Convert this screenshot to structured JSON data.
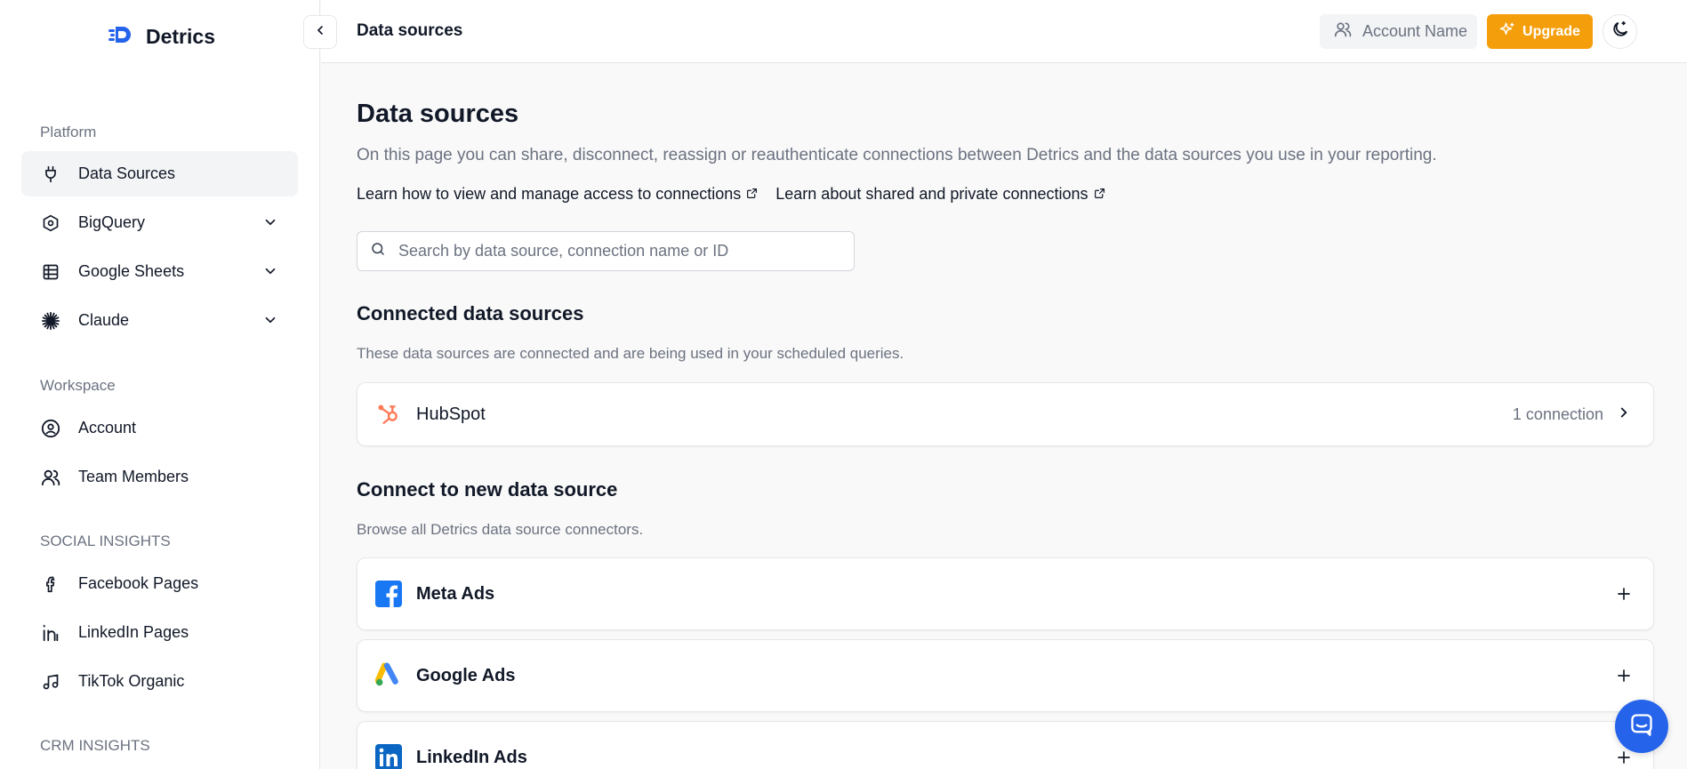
{
  "app": {
    "name": "Detrics"
  },
  "sidebar": {
    "sections": [
      {
        "title": "Platform"
      },
      {
        "title": "Workspace"
      },
      {
        "title": "SOCIAL INSIGHTS"
      },
      {
        "title": "CRM INSIGHTS"
      }
    ],
    "items": [
      {
        "label": "Data Sources",
        "icon": "plug-icon",
        "active": true
      },
      {
        "label": "BigQuery",
        "icon": "bigquery-icon",
        "expandable": true
      },
      {
        "label": "Google Sheets",
        "icon": "table-icon",
        "expandable": true
      },
      {
        "label": "Claude",
        "icon": "claude-icon",
        "expandable": true
      },
      {
        "label": "Account",
        "icon": "user-circle-icon"
      },
      {
        "label": "Team Members",
        "icon": "users-icon"
      },
      {
        "label": "Facebook Pages",
        "icon": "facebook-icon"
      },
      {
        "label": "LinkedIn Pages",
        "icon": "linkedin-icon"
      },
      {
        "label": "TikTok Organic",
        "icon": "music-note-icon"
      }
    ]
  },
  "header": {
    "title": "Data sources",
    "account_label": "Account Name",
    "upgrade_label": "Upgrade"
  },
  "main": {
    "title": "Data sources",
    "description": "On this page you can share, disconnect, reassign or reauthenticate connections between Detrics and the data sources you use in your reporting.",
    "links": [
      "Learn how to view and manage access to connections",
      "Learn about shared and private connections"
    ],
    "search_placeholder": "Search by data source, connection name or ID",
    "connected": {
      "title": "Connected data sources",
      "subtitle": "These data sources are connected and are being used in your scheduled queries.",
      "items": [
        {
          "name": "HubSpot",
          "meta": "1 connection",
          "icon": "hubspot-icon"
        }
      ]
    },
    "new_source": {
      "title": "Connect to new data source",
      "subtitle": "Browse all Detrics data source connectors.",
      "items": [
        {
          "name": "Meta Ads",
          "icon": "meta-icon"
        },
        {
          "name": "Google Ads",
          "icon": "google-ads-icon"
        },
        {
          "name": "LinkedIn Ads",
          "icon": "linkedin-ads-icon"
        }
      ]
    }
  },
  "colors": {
    "accent": "#f59e0b",
    "hubspot": "#ff7a59",
    "facebook": "#1877f2",
    "linkedin": "#0a66c2",
    "chat": "#2563eb"
  }
}
